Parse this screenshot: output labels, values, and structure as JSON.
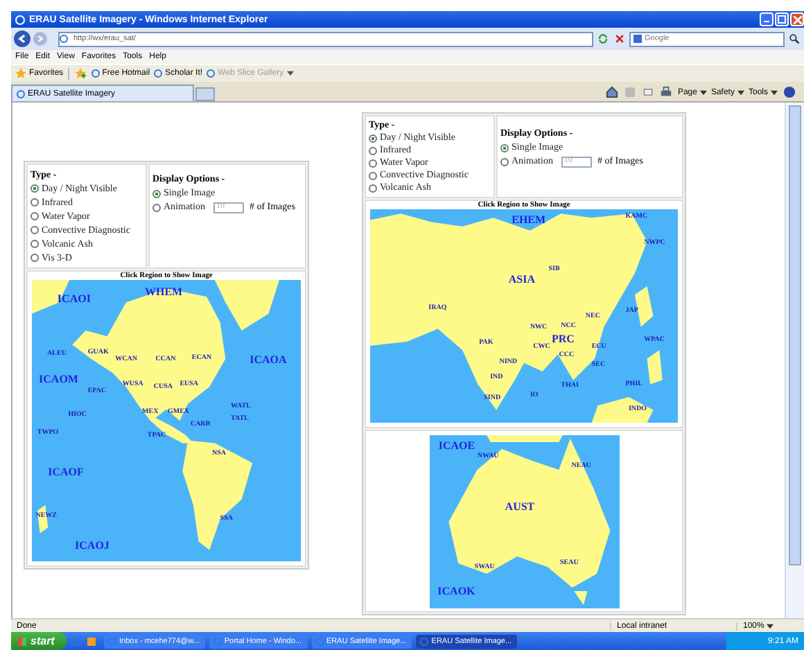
{
  "window": {
    "title": "ERAU Satellite Imagery - Windows Internet Explorer"
  },
  "address_bar": {
    "url": "http://wx/erau_sat/",
    "search_placeholder": "Google"
  },
  "menu_bar": [
    "File",
    "Edit",
    "View",
    "Favorites",
    "Tools",
    "Help"
  ],
  "favorites_bar": {
    "favorites": "Favorites",
    "links": [
      {
        "label": "Free Hotmail",
        "disabled": false,
        "dropdown": false
      },
      {
        "label": "Scholar It!",
        "disabled": false,
        "dropdown": false
      },
      {
        "label": "Web Slice Gallery",
        "disabled": true,
        "dropdown": true
      }
    ]
  },
  "tabs": [
    {
      "label": "ERAU Satellite Imagery",
      "selected": true
    }
  ],
  "command_bar": [
    "Page",
    "Safety",
    "Tools"
  ],
  "panels": [
    {
      "type_heading": "Type -",
      "types": [
        {
          "label": "Day / Night Visible",
          "selected": true
        },
        {
          "label": "Infrared",
          "selected": false
        },
        {
          "label": "Water Vapor",
          "selected": false
        },
        {
          "label": "Convective Diagnostic",
          "selected": false
        },
        {
          "label": "Volcanic Ash",
          "selected": false
        },
        {
          "label": "Vis 3-D",
          "selected": false
        }
      ],
      "display_heading": "Display Options -",
      "display_options": [
        {
          "label": "Single Image",
          "selected": true
        },
        {
          "label": "Animation",
          "selected": false
        }
      ],
      "image_count": "10",
      "image_count_label": "# of Images",
      "map_caption": "Click Region to Show Image",
      "map_regions": [
        "ICAOI",
        "WHEM",
        "ALEU",
        "GUAK",
        "WCAN",
        "CCAN",
        "ECAN",
        "ICAOA",
        "ICAOM",
        "EPAC",
        "WUSA",
        "CUSA",
        "EUSA",
        "WATL",
        "HIOC",
        "MEX",
        "GMEX",
        "TATL",
        "CARB",
        "TWPO",
        "TPAC",
        "ICAOF",
        "NSA",
        "NEWZ",
        "SSA",
        "ICAOJ"
      ]
    },
    {
      "type_heading": "Type -",
      "types": [
        {
          "label": "Day / Night Visible",
          "selected": true
        },
        {
          "label": "Infrared",
          "selected": false
        },
        {
          "label": "Water Vapor",
          "selected": false
        },
        {
          "label": "Convective Diagnostic",
          "selected": false
        },
        {
          "label": "Volcanic Ash",
          "selected": false
        }
      ],
      "display_heading": "Display Options -",
      "display_options": [
        {
          "label": "Single Image",
          "selected": true
        },
        {
          "label": "Animation",
          "selected": false
        }
      ],
      "image_count": "10",
      "image_count_label": "# of Images",
      "map_caption": "Click Region to Show Image",
      "map_regions": [
        "EHEM",
        "KAMC",
        "NWPC",
        "SIB",
        "ASIA",
        "IRAQ",
        "NEC",
        "JAP",
        "NWC",
        "NCC",
        "WPAC",
        "PAK",
        "PRC",
        "CWC",
        "ECU",
        "CCC",
        "NIND",
        "SEC",
        "IND",
        "THAI",
        "PHIL",
        "SIND",
        "IO",
        "INDO"
      ]
    }
  ],
  "aust_map": {
    "regions": [
      "ICAOE",
      "NWAU",
      "NEAU",
      "AUST",
      "SEAU",
      "SWAU",
      "ICAOK"
    ]
  },
  "status_bar": {
    "text": "Done",
    "zone": "Local intranet",
    "zoom": "100%"
  },
  "taskbar": {
    "start": "start",
    "items": [
      {
        "label": "Inbox - mcehe774@w...",
        "selected": false
      },
      {
        "label": "Portal Home - Windo...",
        "selected": false
      },
      {
        "label": "ERAU Satellite Image...",
        "selected": false
      },
      {
        "label": "ERAU Satellite Image...",
        "selected": true
      }
    ],
    "clock": "9:21 AM"
  }
}
